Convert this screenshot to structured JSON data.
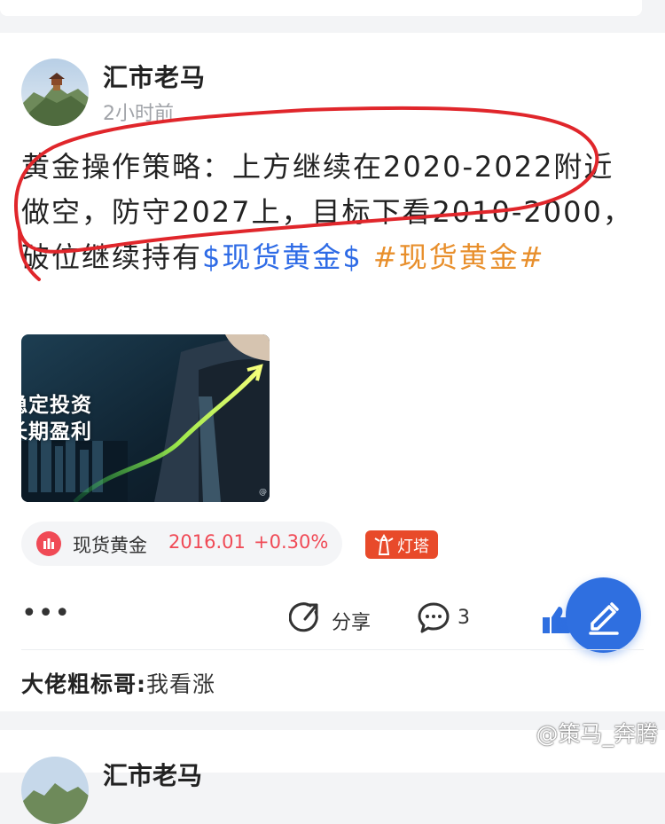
{
  "post": {
    "author": "汇市老马",
    "time": "2小时前",
    "text_main": "黄金操作策略：上方继续在2020-2022附近做空，防守2027上，目标下看2010-2000，破位继续持有",
    "stock_link": "$现货黄金$",
    "hashtag": " #现货黄金#",
    "image_caption_line1": "稳定投资",
    "image_caption_line2": "长期盈利",
    "image_corner_mark": "@"
  },
  "quote": {
    "name": "现货黄金",
    "price": "2016.01",
    "change": "+0.30%",
    "color": "#f04a56"
  },
  "tag": {
    "label": "灯塔",
    "color": "#e84a2a"
  },
  "actions": {
    "more": "•••",
    "share_label": "分享",
    "comment_count": "3"
  },
  "comment_preview": {
    "author": "大佬粗标哥:",
    "text": "我看涨"
  },
  "next_post": {
    "author": "汇市老马"
  },
  "watermark": "@策马_奔腾",
  "colors": {
    "link_blue": "#2e6be6",
    "hashtag_orange": "#e88f2c",
    "fab_blue": "#2f6fe0",
    "annotation_red": "#e0262b"
  },
  "icons": [
    "mountain-avatar-image",
    "bar-chart-icon",
    "lighthouse-icon",
    "share-arrow-icon",
    "comment-bubble-icon",
    "thumbs-up-icon",
    "pencil-icon"
  ]
}
